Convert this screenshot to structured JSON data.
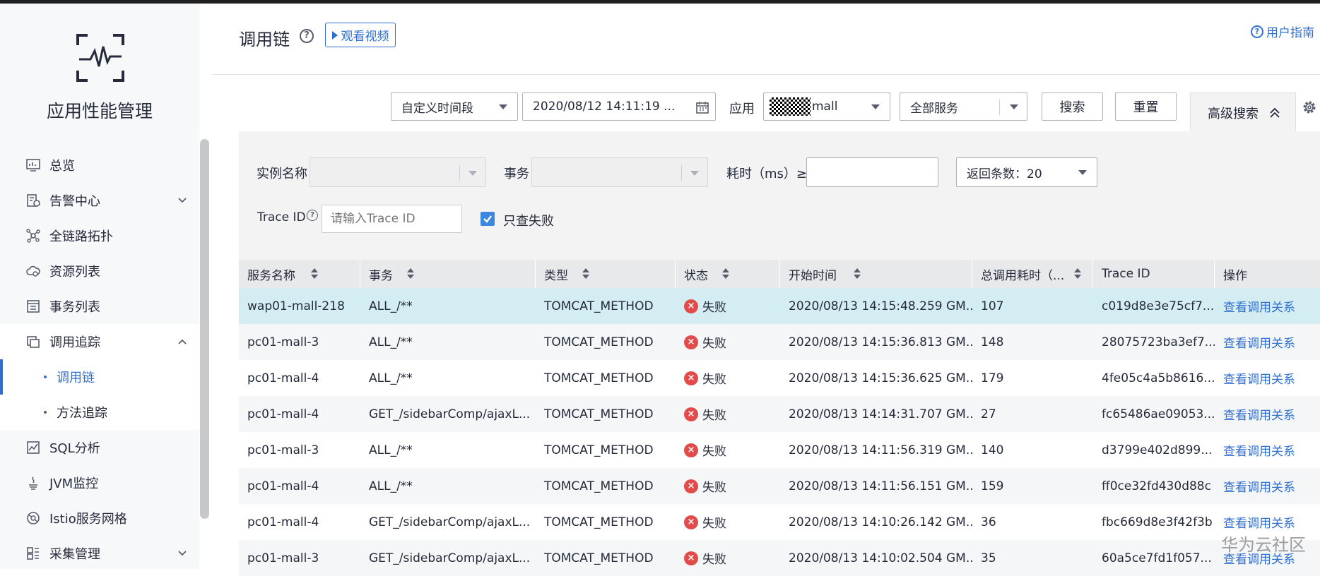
{
  "sidebar": {
    "app_title": "应用性能管理",
    "items": [
      {
        "label": "总览",
        "icon": "dashboard-icon"
      },
      {
        "label": "告警中心",
        "icon": "alarm-icon",
        "expandable": true
      },
      {
        "label": "全链路拓扑",
        "icon": "topology-icon"
      },
      {
        "label": "资源列表",
        "icon": "cloud-icon"
      },
      {
        "label": "事务列表",
        "icon": "list-icon"
      },
      {
        "label": "调用追踪",
        "icon": "trace-icon",
        "expanded": true,
        "children": [
          {
            "label": "调用链",
            "active": true
          },
          {
            "label": "方法追踪"
          }
        ]
      },
      {
        "label": "SQL分析",
        "icon": "chart-icon"
      },
      {
        "label": "JVM监控",
        "icon": "java-icon"
      },
      {
        "label": "Istio服务网格",
        "icon": "mesh-icon"
      },
      {
        "label": "采集管理",
        "icon": "collect-icon",
        "expandable": true
      }
    ]
  },
  "header": {
    "title": "调用链",
    "video_label": "观看视频",
    "guide_label": "用户指南"
  },
  "toolbar": {
    "time_range": "自定义时间段",
    "date_value": "2020/08/12 14:11:19 ...",
    "app_label": "应用",
    "app_value": "mall",
    "service_value": "全部服务",
    "search_label": "搜索",
    "reset_label": "重置",
    "advanced_label": "高级搜索"
  },
  "advanced": {
    "instance_label": "实例名称",
    "transaction_label": "事务",
    "duration_label": "耗时（ms）≥",
    "return_count_label": "返回条数：20",
    "trace_id_label": "Trace ID",
    "trace_id_placeholder": "请输入Trace ID",
    "only_failed_label": "只查失败"
  },
  "table": {
    "columns": [
      "服务名称",
      "事务",
      "类型",
      "状态",
      "开始时间",
      "总调用耗时（...",
      "Trace ID",
      "操作"
    ],
    "rows": [
      {
        "service": "wap01-mall-218",
        "transaction": "ALL_/**",
        "type": "TOMCAT_METHOD",
        "status": "失败",
        "start": "2020/08/13 14:15:48.259 GM...",
        "duration": "107",
        "trace_id": "c019d8e3e75cf7...",
        "action": "查看调用关系"
      },
      {
        "service": "pc01-mall-3",
        "transaction": "ALL_/**",
        "type": "TOMCAT_METHOD",
        "status": "失败",
        "start": "2020/08/13 14:15:36.813 GM...",
        "duration": "148",
        "trace_id": "28075723ba3ef7...",
        "action": "查看调用关系"
      },
      {
        "service": "pc01-mall-4",
        "transaction": "ALL_/**",
        "type": "TOMCAT_METHOD",
        "status": "失败",
        "start": "2020/08/13 14:15:36.625 GM...",
        "duration": "179",
        "trace_id": "4fe05c4a5b8616...",
        "action": "查看调用关系"
      },
      {
        "service": "pc01-mall-4",
        "transaction": "GET_/sidebarComp/ajaxL...",
        "type": "TOMCAT_METHOD",
        "status": "失败",
        "start": "2020/08/13 14:14:31.707 GM...",
        "duration": "27",
        "trace_id": "fc65486ae09053...",
        "action": "查看调用关系"
      },
      {
        "service": "pc01-mall-3",
        "transaction": "ALL_/**",
        "type": "TOMCAT_METHOD",
        "status": "失败",
        "start": "2020/08/13 14:11:56.319 GM...",
        "duration": "140",
        "trace_id": "d3799e402d899...",
        "action": "查看调用关系"
      },
      {
        "service": "pc01-mall-4",
        "transaction": "ALL_/**",
        "type": "TOMCAT_METHOD",
        "status": "失败",
        "start": "2020/08/13 14:11:56.151 GM...",
        "duration": "159",
        "trace_id": "ff0ce32fd430d88c",
        "action": "查看调用关系"
      },
      {
        "service": "pc01-mall-4",
        "transaction": "GET_/sidebarComp/ajaxL...",
        "type": "TOMCAT_METHOD",
        "status": "失败",
        "start": "2020/08/13 14:10:26.142 GM...",
        "duration": "36",
        "trace_id": "fbc669d8e3f42f3b",
        "action": "查看调用关系"
      },
      {
        "service": "pc01-mall-3",
        "transaction": "GET_/sidebarComp/ajaxL...",
        "type": "TOMCAT_METHOD",
        "status": "失败",
        "start": "2020/08/13 14:10:02.504 GM...",
        "duration": "35",
        "trace_id": "60a5ce7fd1f057...",
        "action": "查看调用关系"
      }
    ]
  },
  "watermark": "华为云社区",
  "colors": {
    "accent": "#2f6fd1",
    "fail": "#e34b4b",
    "highlight_row": "#d4edf3"
  }
}
